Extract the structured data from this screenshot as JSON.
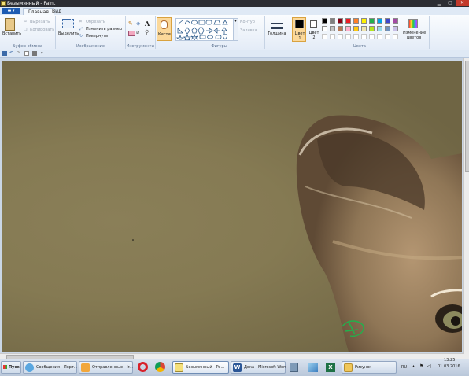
{
  "window": {
    "title": "Безымянный - Paint"
  },
  "tabs": {
    "file": "▬ ▾",
    "home": "Главная",
    "view": "Вид"
  },
  "ribbon": {
    "clipboard": {
      "paste": "Вставить",
      "cut": "Вырезать",
      "copy": "Копировать",
      "group": "Буфер обмена"
    },
    "image": {
      "select": "Выделить",
      "crop": "Обрезать",
      "resize": "Изменить размер",
      "rotate": "Повернуть",
      "group": "Изображение"
    },
    "tools": {
      "group": "Инструменты",
      "text_tool": "A"
    },
    "brushes": {
      "label": "Кисти"
    },
    "shapes": {
      "outline": "Контур",
      "fill": "Заливка",
      "group": "Фигуры"
    },
    "size": {
      "label": "Толщина"
    },
    "colors": {
      "color1": "Цвет 1",
      "color2": "Цвет 2",
      "edit": "Изменение цветов",
      "group": "Цвета",
      "palette_row1": [
        "#000000",
        "#7f7f7f",
        "#880015",
        "#ed1c24",
        "#ff7f27",
        "#fff200",
        "#22b14c",
        "#00a2e8",
        "#3f48cc",
        "#a349a4"
      ],
      "palette_row2": [
        "#ffffff",
        "#c3c3c3",
        "#b97a57",
        "#ffaec9",
        "#ffc90e",
        "#efe4b0",
        "#b5e61d",
        "#99d9ea",
        "#7092be",
        "#c8bfe7"
      ],
      "primary": "#000000",
      "secondary": "#ffffff"
    }
  },
  "taskbar": {
    "start": "Пуск",
    "items": [
      {
        "label": "Сообщения - Порт...",
        "icon": "browser-icon"
      },
      {
        "label": "Отправленные - Ir...",
        "icon": "mail-icon"
      },
      {
        "label": "Безымянный - Pa...",
        "icon": "paint-icon"
      },
      {
        "label": "Дока - Microsoft Word",
        "icon": "word-icon"
      },
      {
        "label": "Рисунок",
        "icon": "folder-icon"
      }
    ],
    "lang": "RU",
    "time": "13:25",
    "date": "01.03.2016"
  }
}
